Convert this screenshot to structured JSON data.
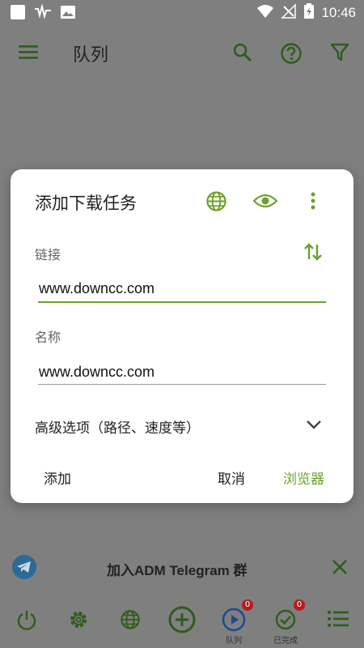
{
  "status_bar": {
    "time": "10:46"
  },
  "app_bar": {
    "title": "队列"
  },
  "dialog": {
    "title": "添加下载任务",
    "link_label": "链接",
    "link_value": "www.downcc.com",
    "name_label": "名称",
    "name_value": "www.downcc.com",
    "advanced_label": "高级选项（路径、速度等）",
    "add_button": "添加",
    "cancel_button": "取消",
    "browser_button": "浏览器"
  },
  "telegram_banner": {
    "text": "加入ADM Telegram 群"
  },
  "bottom_nav": {
    "queue_label": "队列",
    "queue_badge": "0",
    "done_label": "已完成",
    "done_badge": "0"
  },
  "colors": {
    "accent": "#6aa22a",
    "dark_green": "#2e5d1a",
    "badge": "#b71c1c",
    "scrim": "#7f7f7f"
  }
}
